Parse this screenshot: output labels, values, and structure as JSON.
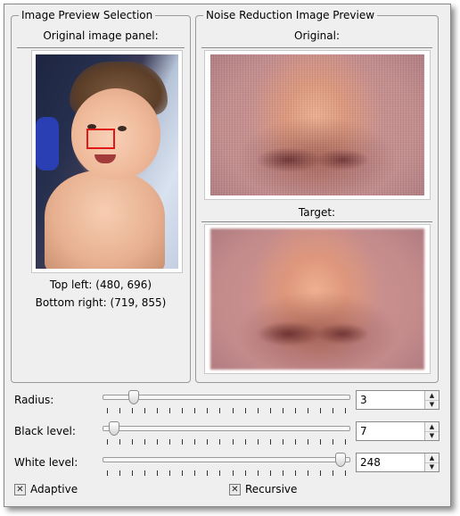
{
  "preview_selection": {
    "title": "Image Preview Selection",
    "panel_label": "Original image panel:",
    "top_left": "Top left: (480, 696)",
    "bottom_right": "Bottom right: (719, 855)"
  },
  "noise_preview": {
    "title": "Noise Reduction Image Preview",
    "original_label": "Original:",
    "target_label": "Target:"
  },
  "sliders": [
    {
      "label": "Radius:",
      "value": "3",
      "position_fraction": 0.12
    },
    {
      "label": "Black level:",
      "value": "7",
      "position_fraction": 0.04
    },
    {
      "label": "White level:",
      "value": "248",
      "position_fraction": 0.96
    }
  ],
  "checkboxes": {
    "adaptive": {
      "label": "Adaptive",
      "checked": true,
      "mark": "✕"
    },
    "recursive": {
      "label": "Recursive",
      "checked": true,
      "mark": "✕"
    }
  },
  "icons": {
    "spin_up": "▲",
    "spin_down": "▼"
  },
  "colors": {
    "selection_box": "#e01818",
    "background": "#efefef"
  }
}
